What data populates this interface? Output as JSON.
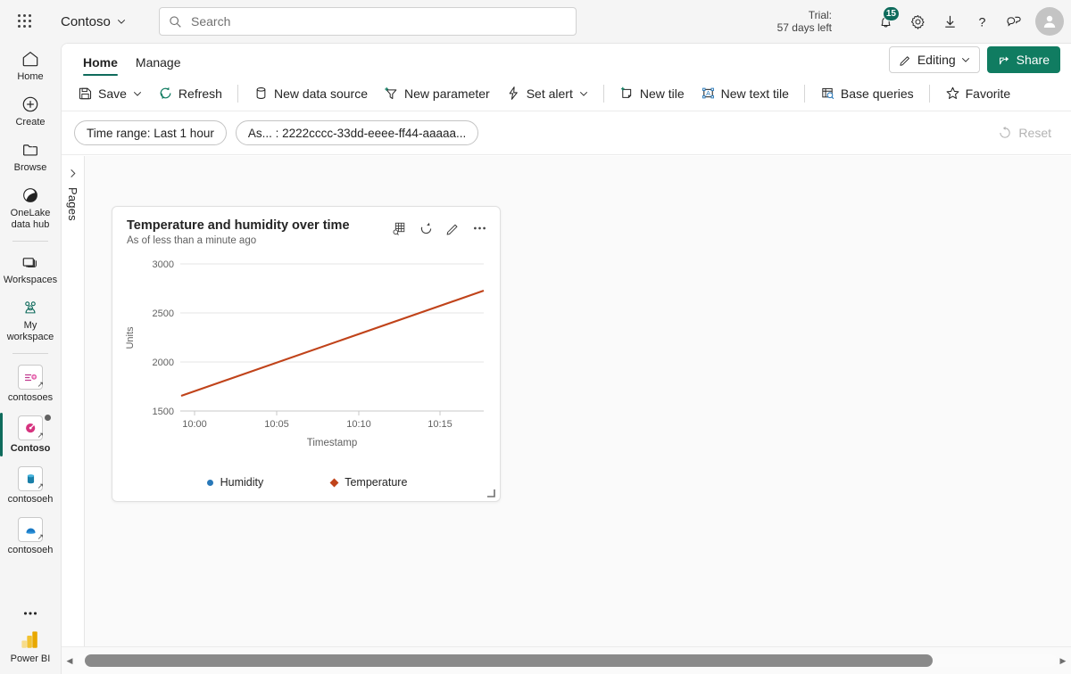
{
  "topbar": {
    "waffle_name": "app-launcher",
    "brand": "Contoso",
    "search_placeholder": "Search",
    "search_value": "",
    "trial_line1": "Trial:",
    "trial_line2": "57 days left",
    "notification_badge": "15",
    "icons": [
      "bell-icon",
      "gear-icon",
      "download-icon",
      "help-icon",
      "feedback-icon"
    ]
  },
  "rail": {
    "items": [
      {
        "label": "Home",
        "icon": "home-icon",
        "selected": false
      },
      {
        "label": "Create",
        "icon": "plus-circle-icon",
        "selected": false
      },
      {
        "label": "Browse",
        "icon": "folder-icon",
        "selected": false
      },
      {
        "label": "OneLake data hub",
        "icon": "onelake-icon",
        "selected": false
      },
      {
        "label": "Workspaces",
        "icon": "workspaces-icon",
        "selected": false
      },
      {
        "label": "My workspace",
        "icon": "my-workspace-icon",
        "selected": false
      },
      {
        "label": "contosoes",
        "icon": "eventstream-icon",
        "selected": false
      },
      {
        "label": "Contoso",
        "icon": "realtime-dashboard-icon",
        "selected": true
      },
      {
        "label": "contosoeh",
        "icon": "eventhouse-icon",
        "selected": false
      },
      {
        "label": "contosoeh",
        "icon": "kql-database-icon",
        "selected": false
      }
    ],
    "more_label": "more-options",
    "product_label": "Power BI"
  },
  "tabs": [
    {
      "label": "Home",
      "active": true
    },
    {
      "label": "Manage",
      "active": false
    }
  ],
  "header_actions": {
    "editing_label": "Editing",
    "editing_icon": "pencil-icon",
    "share_label": "Share",
    "share_icon": "share-icon"
  },
  "commandbar": {
    "items": [
      {
        "label": "Save",
        "icon": "save-icon",
        "chevron": true
      },
      {
        "label": "Refresh",
        "icon": "refresh-icon",
        "chevron": false
      },
      {
        "separator_after": true
      },
      {
        "label": "New data source",
        "icon": "database-icon",
        "chevron": false
      },
      {
        "label": "New parameter",
        "icon": "new-parameter-icon",
        "chevron": false
      },
      {
        "label": "Set alert",
        "icon": "alert-icon",
        "chevron": true
      },
      {
        "separator_after": true
      },
      {
        "label": "New tile",
        "icon": "new-tile-icon",
        "chevron": false
      },
      {
        "label": "New text tile",
        "icon": "new-text-tile-icon",
        "chevron": false
      },
      {
        "separator_after": true
      },
      {
        "label": "Base queries",
        "icon": "base-queries-icon",
        "chevron": false
      },
      {
        "separator_after": true
      },
      {
        "label": "Favorite",
        "icon": "star-icon",
        "chevron": false
      }
    ]
  },
  "filterbar": {
    "pills": [
      {
        "label": "Time range: Last 1 hour"
      },
      {
        "label": "As... : 2222cccc-33dd-eeee-ff44-aaaaa..."
      }
    ],
    "reset_label": "Reset",
    "reset_icon": "reset-icon",
    "reset_disabled": true
  },
  "pages_pane": {
    "label": "Pages",
    "expand_icon": "chevron-right-icon"
  },
  "tile": {
    "title": "Temperature and humidity over time",
    "subtitle": "As of less than a minute ago",
    "actions": [
      {
        "name": "explore-data-icon"
      },
      {
        "name": "refresh-icon"
      },
      {
        "name": "edit-icon"
      },
      {
        "name": "more-options-icon"
      }
    ],
    "resize_handle": "resize-handle"
  },
  "chart_data": {
    "type": "line",
    "title": "Temperature and humidity over time",
    "xlabel": "Timestamp",
    "ylabel": "Units",
    "xtick_labels": [
      "10:00",
      "10:05",
      "10:10",
      "10:15"
    ],
    "ytick_labels": [
      "1500",
      "2000",
      "2500",
      "3000"
    ],
    "ylim": [
      1500,
      3000
    ],
    "grid": true,
    "legend_position": "bottom",
    "series": [
      {
        "name": "Humidity",
        "color": "#2878b8",
        "marker": "circle",
        "x": [],
        "values": []
      },
      {
        "name": "Temperature",
        "color": "#c0431a",
        "marker": "diamond",
        "x": [
          "09:59",
          "10:17"
        ],
        "values": [
          1655,
          2730
        ]
      }
    ]
  },
  "scrollbar": {
    "left_arrow": "scroll-left-icon",
    "right_arrow": "scroll-right-icon"
  },
  "colors": {
    "accent": "#107c61",
    "temperature": "#c0431a",
    "humidity": "#2878b8",
    "badge": "#0f6b5c"
  }
}
